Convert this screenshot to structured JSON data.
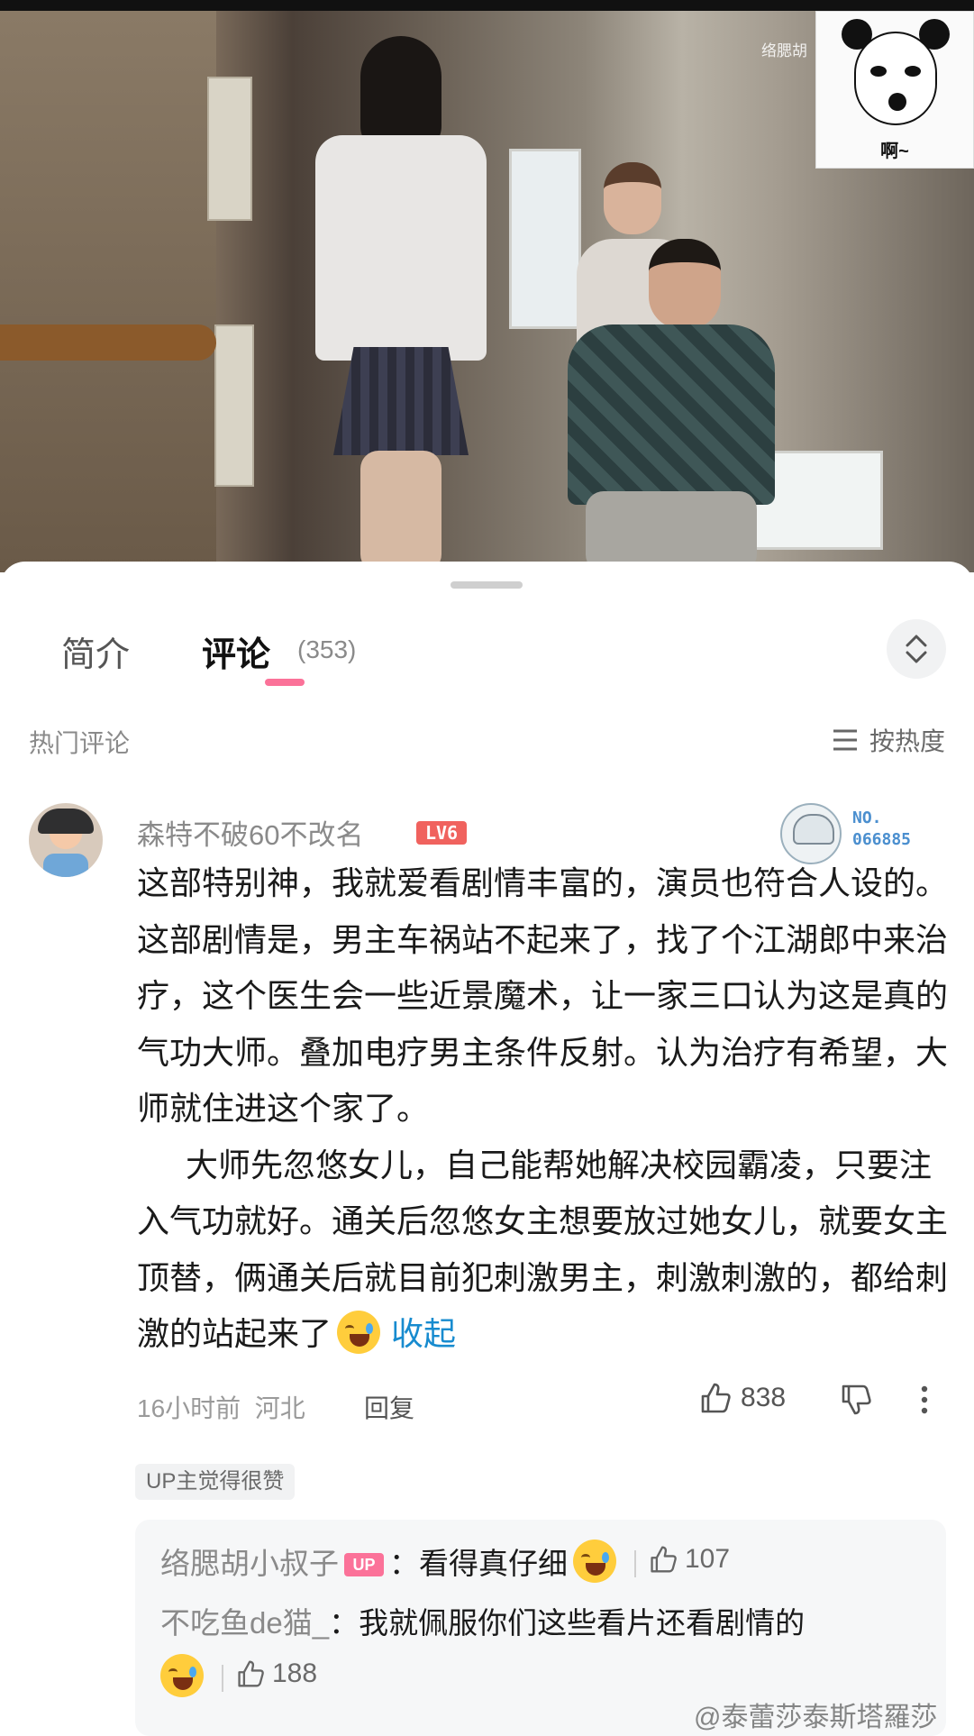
{
  "video": {
    "watermark": "络腮胡",
    "sticker_caption": "啊~"
  },
  "tabs": {
    "intro_label": "简介",
    "comments_label": "评论",
    "comments_count": "(353)"
  },
  "section": {
    "hot_label": "热门评论",
    "sort_label": "按热度"
  },
  "comment": {
    "username": "森特不破60不改名",
    "level": "LV6",
    "fan_badge_no": "NO.",
    "fan_badge_num": "066885",
    "paragraph1": "这部特别神，我就爱看剧情丰富的，演员也符合人设的。这部剧情是，男主车祸站不起来了，找了个江湖郎中来治疗，这个医生会一些近景魔术，让一家三口认为这是真的气功大师。叠加电疗男主条件反射。认为治疗有希望，大师就住进这个家了。",
    "paragraph2": "大师先忽悠女儿，自己能帮她解决校园霸凌，只要注入气功就好。通关后忽悠女主想要放过她女儿，就要女主顶替，俩通关后就目前犯刺激男主，刺激刺激的，都给刺激的站起来了",
    "collapse_label": "收起",
    "time": "16小时前",
    "location": "河北",
    "reply_label": "回复",
    "likes": "838",
    "up_tag": "UP主觉得很赞"
  },
  "replies": [
    {
      "user": "络腮胡小叔子",
      "badge": "UP",
      "text": "：看得真仔细",
      "likes": "107"
    },
    {
      "user": "不吃鱼de猫_",
      "text": "：我就佩服你们这些看片还看剧情的",
      "likes": "188"
    }
  ],
  "footer": {
    "weibo_watermark": "@泰蕾莎泰斯塔羅莎"
  },
  "colors": {
    "accent": "#fb7299",
    "link": "#178bcf",
    "level_badge": "#f0625e"
  }
}
